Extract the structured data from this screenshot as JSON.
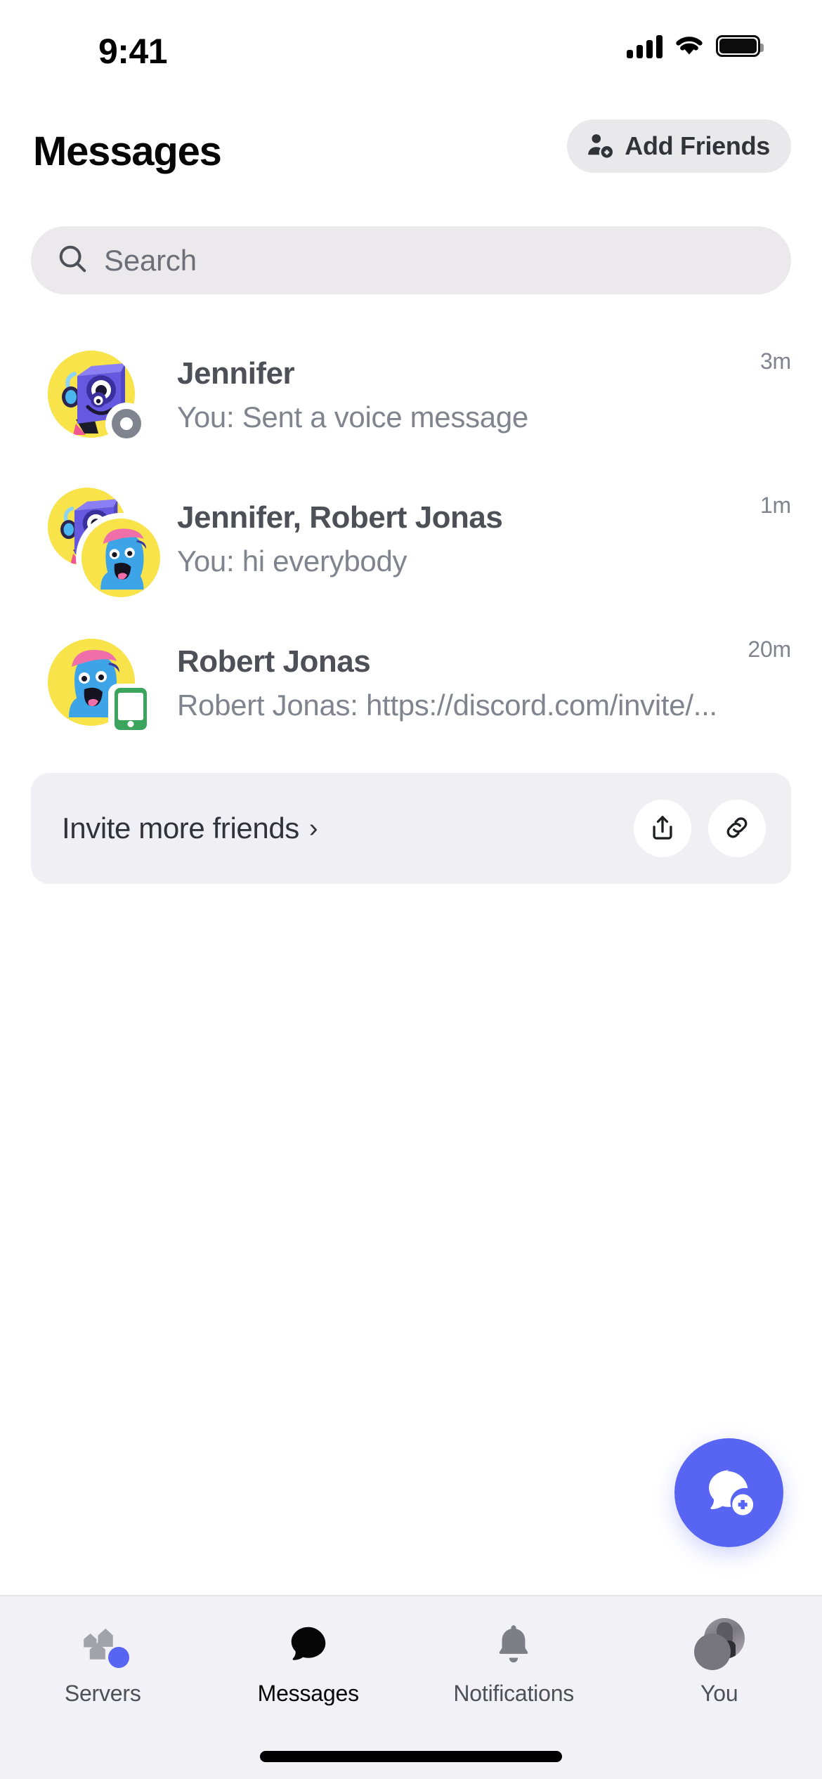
{
  "status_bar": {
    "time": "9:41",
    "cellular_icon": "cellular-signal-icon",
    "wifi_icon": "wifi-icon",
    "battery_icon": "battery-full-icon"
  },
  "header": {
    "title": "Messages",
    "add_friends": {
      "label": "Add Friends",
      "icon": "person-add-icon",
      "background": "#E9E8EB"
    }
  },
  "search": {
    "placeholder": "Search",
    "value": "",
    "icon": "search-icon",
    "background": "#EBE9EC"
  },
  "conversations": [
    {
      "name": "Jennifer",
      "preview": "You: Sent a voice message",
      "time": "3m",
      "avatar_kind": "single",
      "avatar_background": "#F8E44A",
      "status": "idle",
      "status_icon": "status-idle-icon"
    },
    {
      "name": "Jennifer, Robert Jonas",
      "preview": "You: hi everybody",
      "time": "1m",
      "avatar_kind": "group",
      "avatar_background": "#F8E44A",
      "status": "none",
      "status_icon": ""
    },
    {
      "name": "Robert Jonas",
      "preview": "Robert Jonas: https://discord.com/invite/...",
      "time": "20m",
      "avatar_kind": "single",
      "avatar_background": "#F8E44A",
      "status": "mobile",
      "status_icon": "status-mobile-online-icon"
    }
  ],
  "invite_card": {
    "label": "Invite more friends",
    "chevron": "›",
    "background": "#F0EFF4",
    "actions": [
      {
        "name": "share",
        "icon": "share-icon"
      },
      {
        "name": "copy-link",
        "icon": "link-icon"
      }
    ]
  },
  "fab": {
    "icon": "new-message-icon",
    "color": "#5865F2"
  },
  "tab_bar": {
    "background": "#F2F1F6",
    "items": [
      {
        "label": "Servers",
        "icon": "servers-icon",
        "active": false,
        "badge": true,
        "badge_color": "#5865F2"
      },
      {
        "label": "Messages",
        "icon": "chat-bubble-icon",
        "active": true,
        "badge": false
      },
      {
        "label": "Notifications",
        "icon": "bell-icon",
        "active": false,
        "badge": false
      },
      {
        "label": "You",
        "icon": "user-avatar-icon",
        "active": false,
        "badge": false
      }
    ]
  }
}
